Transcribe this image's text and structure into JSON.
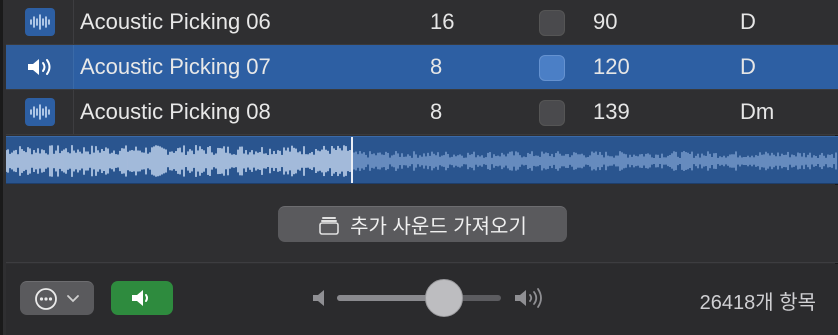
{
  "rows": [
    {
      "icon": "waveform-icon",
      "name": "Acoustic Picking 06",
      "beats": "16",
      "tempo": "90",
      "key": "D",
      "selected": false
    },
    {
      "icon": "speaker-icon",
      "name": "Acoustic Picking 07",
      "beats": "8",
      "tempo": "120",
      "key": "D",
      "selected": true
    },
    {
      "icon": "waveform-icon",
      "name": "Acoustic Picking 08",
      "beats": "8",
      "tempo": "139",
      "key": "Dm",
      "selected": false
    }
  ],
  "import": {
    "label": "추가 사운드 가져오기",
    "icon": "box-stack-icon"
  },
  "footer": {
    "more_icon": "ellipsis-circle-icon",
    "preview_icon": "speaker-icon",
    "volume_level": 0.65,
    "item_count": "26418개 항목"
  },
  "colors": {
    "accent": "#2d5fa3",
    "preview_green": "#2e8b3e"
  }
}
